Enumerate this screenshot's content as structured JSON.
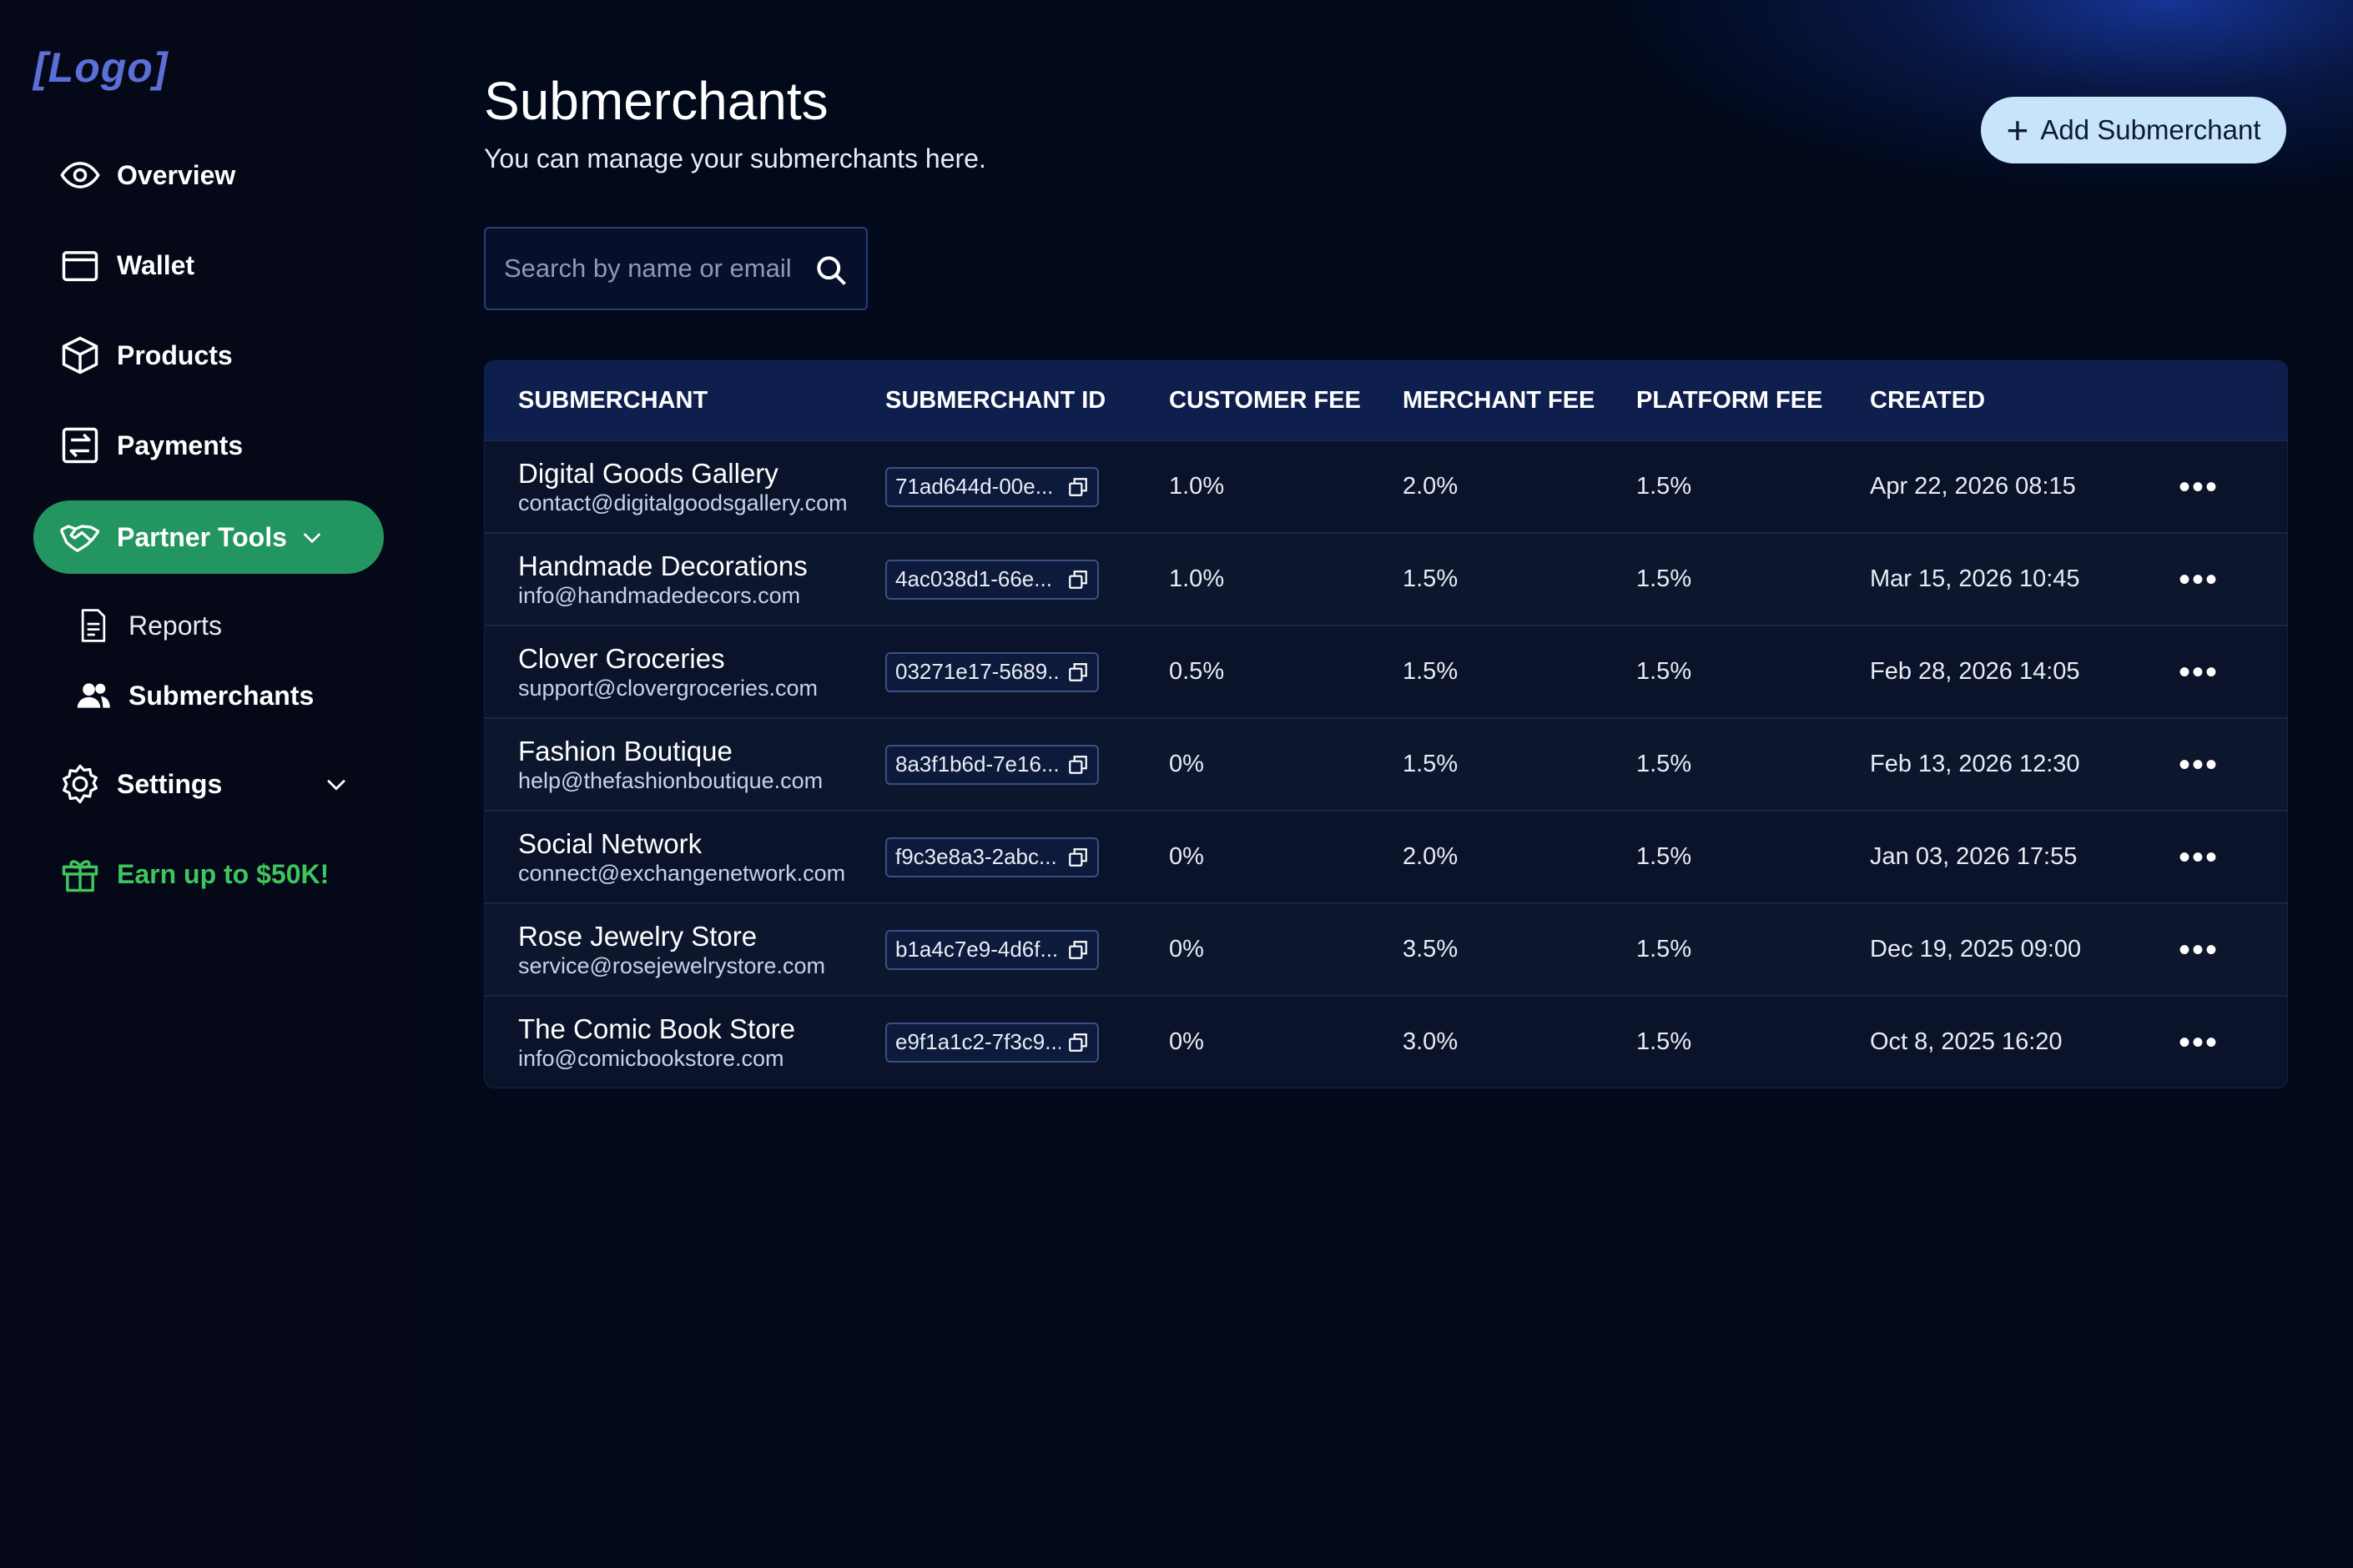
{
  "brand": {
    "logo_text": "[Logo]"
  },
  "sidebar": {
    "items": [
      {
        "label": "Overview",
        "icon": "eye-icon"
      },
      {
        "label": "Wallet",
        "icon": "wallet-icon"
      },
      {
        "label": "Products",
        "icon": "box-icon"
      },
      {
        "label": "Payments",
        "icon": "transfer-icon"
      },
      {
        "label": "Partner Tools",
        "icon": "handshake-icon",
        "active": true,
        "expanded": true
      }
    ],
    "sub_items": [
      {
        "label": "Reports",
        "icon": "document-icon"
      },
      {
        "label": "Submerchants",
        "icon": "users-icon",
        "current": true
      }
    ],
    "settings": {
      "label": "Settings",
      "icon": "gear-icon"
    },
    "promo": {
      "label": "Earn up to $50K!",
      "icon": "gift-icon"
    }
  },
  "header": {
    "title": "Submerchants",
    "subtitle": "You can manage your submerchants here.",
    "add_button_label": "Add Submerchant"
  },
  "search": {
    "placeholder": "Search by name or email",
    "value": ""
  },
  "table": {
    "columns": [
      "SUBMERCHANT",
      "SUBMERCHANT ID",
      "CUSTOMER FEE",
      "MERCHANT FEE",
      "PLATFORM FEE",
      "CREATED"
    ],
    "rows": [
      {
        "name": "Digital Goods Gallery",
        "email": "contact@digitalgoodsgallery.com",
        "id": "71ad644d-00e...",
        "customer_fee": "1.0%",
        "merchant_fee": "2.0%",
        "platform_fee": "1.5%",
        "created": "Apr 22, 2026 08:15"
      },
      {
        "name": "Handmade Decorations",
        "email": "info@handmadedecors.com",
        "id": "4ac038d1-66e...",
        "customer_fee": "1.0%",
        "merchant_fee": "1.5%",
        "platform_fee": "1.5%",
        "created": "Mar 15, 2026 10:45"
      },
      {
        "name": "Clover Groceries",
        "email": "support@clovergroceries.com",
        "id": "03271e17-5689...",
        "customer_fee": "0.5%",
        "merchant_fee": "1.5%",
        "platform_fee": "1.5%",
        "created": "Feb 28, 2026 14:05"
      },
      {
        "name": "Fashion Boutique",
        "email": "help@thefashionboutique.com",
        "id": "8a3f1b6d-7e16...",
        "customer_fee": "0%",
        "merchant_fee": "1.5%",
        "platform_fee": "1.5%",
        "created": "Feb 13, 2026 12:30"
      },
      {
        "name": "Social Network",
        "email": "connect@exchangenetwork.com",
        "id": "f9c3e8a3-2abc...",
        "customer_fee": "0%",
        "merchant_fee": "2.0%",
        "platform_fee": "1.5%",
        "created": "Jan 03, 2026 17:55"
      },
      {
        "name": "Rose Jewelry Store",
        "email": "service@rosejewelrystore.com",
        "id": "b1a4c7e9-4d6f...",
        "customer_fee": "0%",
        "merchant_fee": "3.5%",
        "platform_fee": "1.5%",
        "created": "Dec 19, 2025 09:00"
      },
      {
        "name": "The Comic Book Store",
        "email": "info@comicbookstore.com",
        "id": "e9f1a1c2-7f3c9...",
        "customer_fee": "0%",
        "merchant_fee": "3.0%",
        "platform_fee": "1.5%",
        "created": "Oct 8, 2025 16:20"
      }
    ],
    "row_action_icon": "more-dots-icon"
  },
  "colors": {
    "background": "#02091a",
    "sidebar": "#040817",
    "active_nav": "#229561",
    "promo_green": "#3fc55e",
    "logo": "#5b6fd6",
    "add_button_bg": "#c8e4fb",
    "table_header": "#0f1f4d"
  }
}
